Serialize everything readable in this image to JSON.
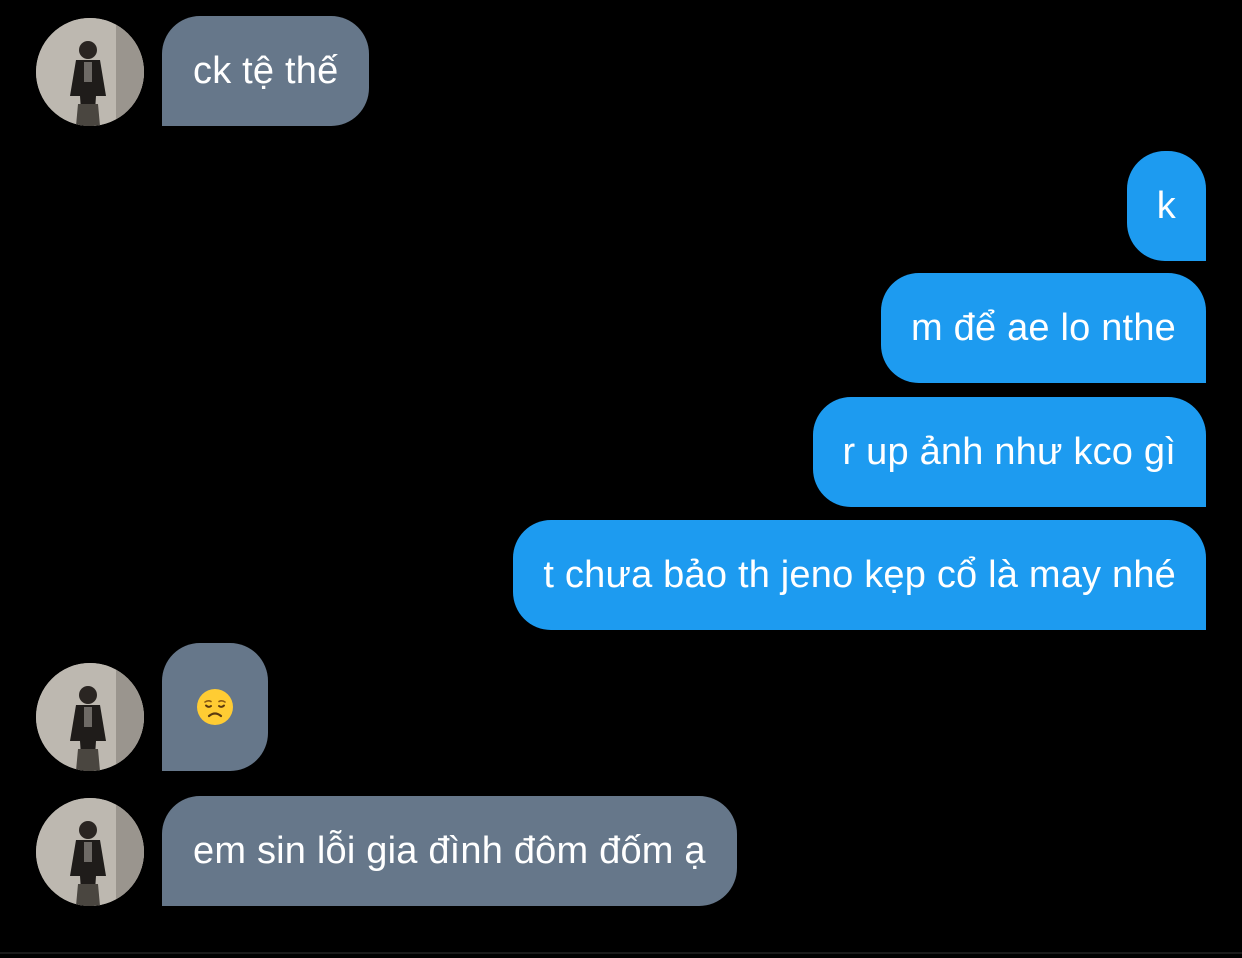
{
  "colors": {
    "background": "#000000",
    "incoming_bubble": "#66778a",
    "outgoing_bubble": "#1d9bf0",
    "text": "#ffffff"
  },
  "messages": [
    {
      "direction": "incoming",
      "text": "ck tệ thế"
    },
    {
      "direction": "outgoing",
      "text": "k"
    },
    {
      "direction": "outgoing",
      "text": "m để ae lo nthe"
    },
    {
      "direction": "outgoing",
      "text": "r up ảnh như kco gì"
    },
    {
      "direction": "outgoing",
      "text": "t chưa bảo th jeno kẹp cổ là may nhé"
    },
    {
      "direction": "incoming",
      "emoji": "disappointed-face-emoji"
    },
    {
      "direction": "incoming",
      "text": "em sin lỗi gia đình đôm đốm ạ"
    }
  ]
}
